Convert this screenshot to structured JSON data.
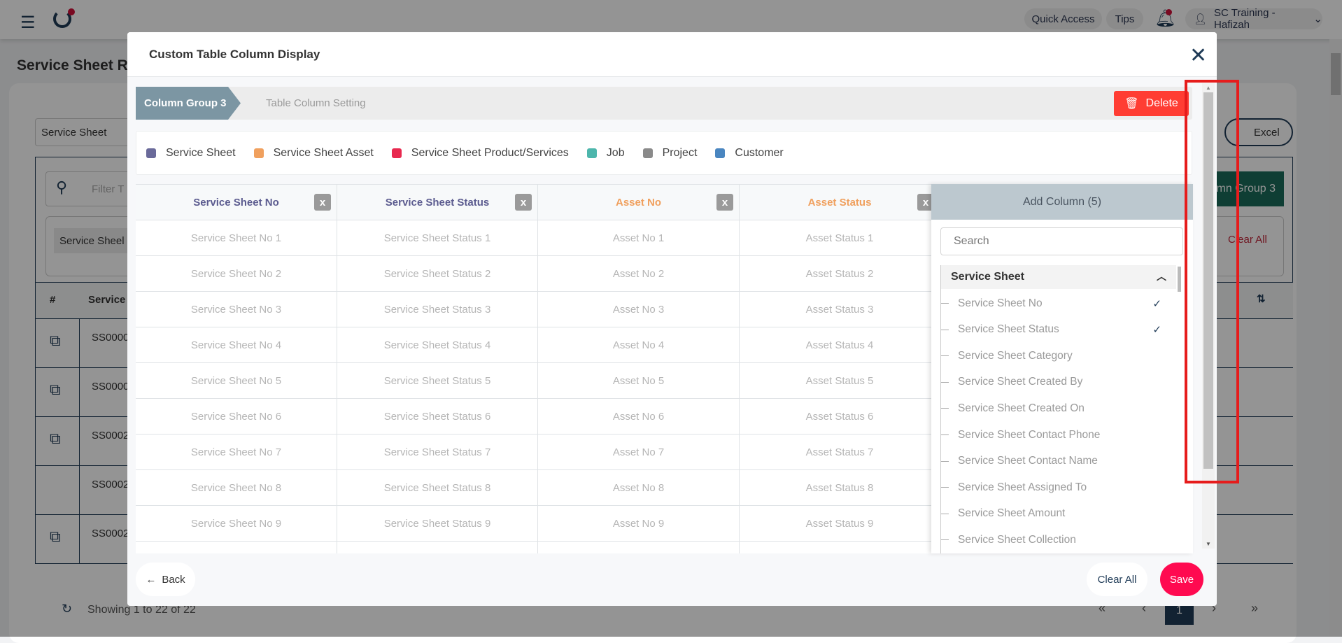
{
  "background": {
    "quick_access": "Quick Access",
    "tips": "Tips",
    "user": "SC Training - Hafizah",
    "page_title": "Service Sheet Re",
    "module_select": "Service Sheet",
    "excel": "Excel",
    "filter_placeholder": "Filter T",
    "column_group_btn": "mn Group 3",
    "chip": "Service Sheel",
    "clear_all": "Clear All",
    "col_hash": "#",
    "col_service": "Service",
    "rows": [
      "SS0000",
      "SS0000",
      "SS0002",
      "SS0002",
      "SS0002"
    ],
    "showing": "Showing 1 to 22 of 22",
    "page": "1"
  },
  "modal": {
    "title": "Custom Table Column Display",
    "steps": [
      "Column Group 3",
      "Table Column Setting"
    ],
    "delete": "Delete",
    "legend": [
      {
        "label": "Service Sheet",
        "color": "#6a6a9a"
      },
      {
        "label": "Service Sheet Asset",
        "color": "#f0a05e"
      },
      {
        "label": "Service Sheet Product/Services",
        "color": "#e8294f"
      },
      {
        "label": "Job",
        "color": "#4db6ac"
      },
      {
        "label": "Project",
        "color": "#8a8a8a"
      },
      {
        "label": "Customer",
        "color": "#4a86c0"
      }
    ],
    "columns": [
      {
        "label": "Service Sheet No",
        "color": "#5b5b8f",
        "cells": [
          "Service Sheet No 1",
          "Service Sheet No 2",
          "Service Sheet No 3",
          "Service Sheet No 4",
          "Service Sheet No 5",
          "Service Sheet No 6",
          "Service Sheet No 7",
          "Service Sheet No 8",
          "Service Sheet No 9"
        ]
      },
      {
        "label": "Service Sheet Status",
        "color": "#5b5b8f",
        "cells": [
          "Service Sheet Status 1",
          "Service Sheet Status 2",
          "Service Sheet Status 3",
          "Service Sheet Status 4",
          "Service Sheet Status 5",
          "Service Sheet Status 6",
          "Service Sheet Status 7",
          "Service Sheet Status 8",
          "Service Sheet Status 9"
        ]
      },
      {
        "label": "Asset No",
        "color": "#f0a05e",
        "cells": [
          "Asset No 1",
          "Asset No 2",
          "Asset No 3",
          "Asset No 4",
          "Asset No 5",
          "Asset No 6",
          "Asset No 7",
          "Asset No 8",
          "Asset No 9"
        ]
      },
      {
        "label": "Asset Status",
        "color": "#f0a05e",
        "cells": [
          "Asset Status 1",
          "Asset Status 2",
          "Asset Status 3",
          "Asset Status 4",
          "Asset Status 5",
          "Asset Status 6",
          "Asset Status 7",
          "Asset Status 8",
          "Asset Status 9"
        ]
      }
    ],
    "remove_label": "x",
    "add_column": {
      "title": "Add Column (5)",
      "search_placeholder": "Search",
      "group": "Service Sheet",
      "items": [
        {
          "label": "Service Sheet No",
          "checked": true
        },
        {
          "label": "Service Sheet Status",
          "checked": true
        },
        {
          "label": "Service Sheet Category",
          "checked": false
        },
        {
          "label": "Service Sheet Created By",
          "checked": false
        },
        {
          "label": "Service Sheet Created On",
          "checked": false
        },
        {
          "label": "Service Sheet Contact Phone",
          "checked": false
        },
        {
          "label": "Service Sheet Contact Name",
          "checked": false
        },
        {
          "label": "Service Sheet Assigned To",
          "checked": false
        },
        {
          "label": "Service Sheet Amount",
          "checked": false
        },
        {
          "label": "Service Sheet Collection",
          "checked": false
        }
      ]
    },
    "back": "Back",
    "clear_all": "Clear All",
    "save": "Save"
  }
}
